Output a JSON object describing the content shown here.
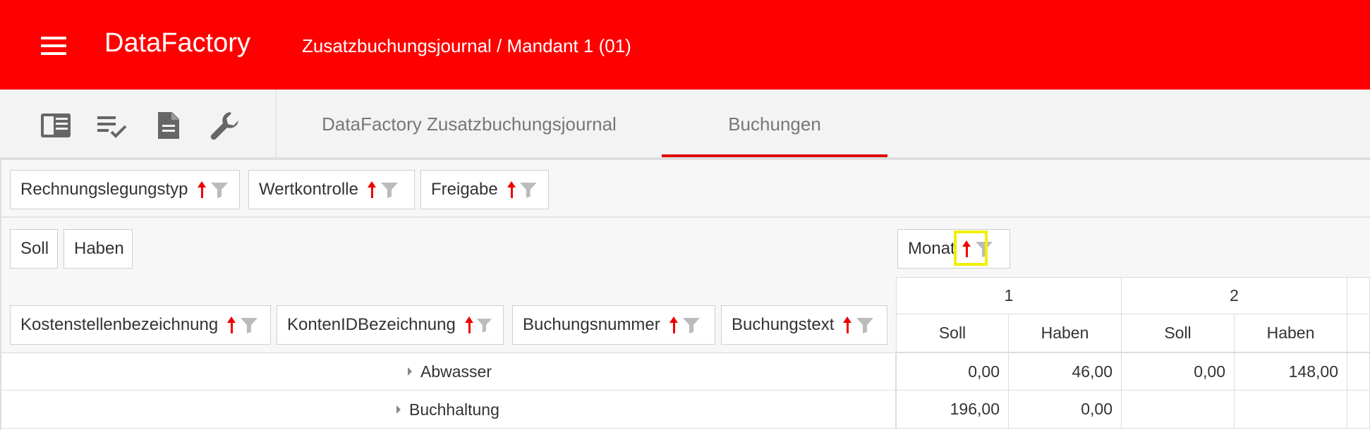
{
  "header": {
    "brand": "DataFactory",
    "title": "Zusatzbuchungsjournal / Mandant 1 (01)"
  },
  "toolbar": {
    "icons": [
      "list-view-icon",
      "checklist-icon",
      "document-icon",
      "wrench-icon"
    ]
  },
  "tabs": [
    {
      "label": "DataFactory Zusatzbuchungsjournal",
      "active": false
    },
    {
      "label": "Buchungen",
      "active": true
    }
  ],
  "filter_fields": [
    {
      "label": "Rechnungslegungstyp"
    },
    {
      "label": "Wertkontrolle"
    },
    {
      "label": "Freigabe"
    }
  ],
  "data_fields": [
    {
      "label": "Soll"
    },
    {
      "label": "Haben"
    }
  ],
  "column_fields": [
    {
      "label": "Monat"
    }
  ],
  "row_fields": [
    {
      "label": "Kostenstellenbezeichnung"
    },
    {
      "label": "KontenIDBezeichnung"
    },
    {
      "label": "Buchungsnummer"
    },
    {
      "label": "Buchungstext"
    }
  ],
  "columns": {
    "months": [
      "1",
      "2"
    ],
    "measures": [
      "Soll",
      "Haben",
      "Soll",
      "Haben"
    ]
  },
  "rows": [
    {
      "label": "Abwasser",
      "values": [
        "0,00",
        "46,00",
        "0,00",
        "148,00"
      ]
    },
    {
      "label": "Buchhaltung",
      "values": [
        "196,00",
        "0,00",
        "",
        ""
      ]
    }
  ],
  "colors": {
    "primary": "#ff0000",
    "arrow": "#ee0000",
    "highlight": "#f0f000"
  }
}
